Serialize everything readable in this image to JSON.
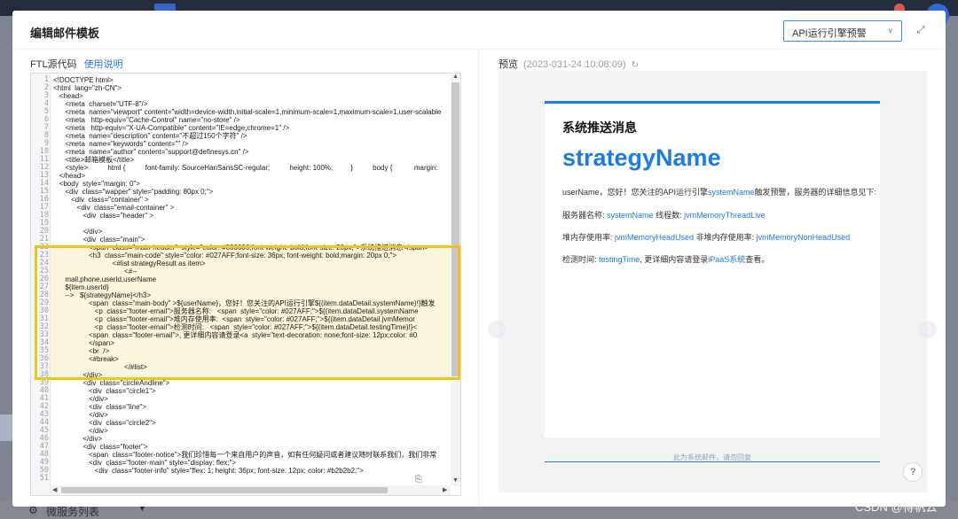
{
  "modal": {
    "title": "编辑邮件模板",
    "template_select": "API运行引擎预警",
    "expand_icon": "fullscreen-icon"
  },
  "editor": {
    "label": "FTL源代码",
    "help_link": "使用说明",
    "lines": [
      {
        "n": "1",
        "t": "<!DOCTYPE html>"
      },
      {
        "n": "2",
        "t": "<html  lang=\"zh-CN\">"
      },
      {
        "n": "3",
        "t": "   <head>"
      },
      {
        "n": "4",
        "t": "      <meta  charset=\"UTF-8\"/>"
      },
      {
        "n": "5",
        "t": "      <meta  name=\"viewport\" content=\"width=device-width,initial-scale=1,minimum-scale=1,maximum-scale=1,user-scalable"
      },
      {
        "n": "6",
        "t": "      <meta   http-equiv=\"Cache-Control\" name=\"no-store\" />"
      },
      {
        "n": "7",
        "t": "      <meta   http-equiv=\"X-UA-Compatible\" content=\"IE=edge,chrome=1\" />"
      },
      {
        "n": "8",
        "t": "      <meta  name=\"description\" content=\"不超过150个字符\" />"
      },
      {
        "n": "9",
        "t": "      <meta  name=\"keywords\" content=\"\" />"
      },
      {
        "n": "10",
        "t": "      <meta  name=\"author\" content=\"support@definesys.cn\" />"
      },
      {
        "n": "11",
        "t": "      <title>邮箱模板</title>"
      },
      {
        "n": "12",
        "t": "      <style>          html {          font-family: SourceHanSansSC-regular;          height: 100%;         }          body {           margin:"
      },
      {
        "n": "13",
        "t": "   </head>"
      },
      {
        "n": "14",
        "t": "   <body  style=\"margin: 0\">"
      },
      {
        "n": "15",
        "t": "      <div  class=\"wapper\" style=\"padding: 80px 0;\">"
      },
      {
        "n": "16",
        "t": "         <div  class=\"container\" >"
      },
      {
        "n": "17",
        "t": "            <div  class=\"email-container\" >"
      },
      {
        "n": "18",
        "t": "               <div  class=\"header\" >"
      },
      {
        "n": "19",
        "t": ""
      },
      {
        "n": "20",
        "t": "               </div>"
      },
      {
        "n": "21",
        "t": "               <div  class=\"main\">"
      },
      {
        "n": "22",
        "t": "                  <span  class=\"main-header\"  style=\"color: #000000;font-weight: bold;font-size: 20px;\">系统推送消息</span>"
      },
      {
        "n": "23",
        "t": "                  <h3  class=\"main-code\" style=\"color: #027AFF;font-size: 36px; font-weight: bold;margin: 20px 0;\">"
      },
      {
        "n": "24",
        "t": "                              <#list strategyResult as item>"
      },
      {
        "n": "25",
        "t": "                                    <#--"
      },
      {
        "n": "26",
        "t": "      mail,phone,userId,userName"
      },
      {
        "n": "27",
        "t": "      ${item.userId}"
      },
      {
        "n": "28",
        "t": "      -->   ${strategyName}</h3>"
      },
      {
        "n": "29",
        "t": "                  <span  class=\"main-body\" >${userName}，您好！您关注的API运行引擎${(item.dataDetail.systemName)!}触发"
      },
      {
        "n": "30",
        "t": "                     <p  class=\"footer-email\">服务器名称:   <span  style=\"color: #027AFF;\">${(item.dataDetail.systemName"
      },
      {
        "n": "31",
        "t": "                     <p  class=\"footer-email\">堆内存使用率:  <span  style=\"color: #027AFF;\">${(item.dataDetail.jvmMemor"
      },
      {
        "n": "32",
        "t": "                     <p  class=\"footer-email\">检测时间:   <span  style=\"color: #027AFF;\">${(item.dataDetail.testingTime)!}<"
      },
      {
        "n": "33",
        "t": "                  <span  class=\"footer-email\">, 更详细内容请登录<a  style=\"text-decoration: none;font-size: 12px;color: #0"
      },
      {
        "n": "34",
        "t": "                  </span>"
      },
      {
        "n": "35",
        "t": "                  <br  />"
      },
      {
        "n": "36",
        "t": "                  <#break>"
      },
      {
        "n": "37",
        "t": "                                    </#list>"
      },
      {
        "n": "38",
        "t": "               </div>"
      },
      {
        "n": "39",
        "t": "               <div  class=\"circleAndline\">"
      },
      {
        "n": "40",
        "t": "                  <div  class=\"circle1\">"
      },
      {
        "n": "41",
        "t": "                  </div>"
      },
      {
        "n": "42",
        "t": "                  <div  class=\"line\">"
      },
      {
        "n": "43",
        "t": "                  </div>"
      },
      {
        "n": "44",
        "t": "                  <div  class=\"circle2\">"
      },
      {
        "n": "45",
        "t": "                  </div>"
      },
      {
        "n": "46",
        "t": "               </div>"
      },
      {
        "n": "47",
        "t": "               <div  class=\"footer\">"
      },
      {
        "n": "48",
        "t": "                  <span  class=\"footer-notice\">我们珍惜每一个来自用户的声音，如有任何疑问或者建议随时联系我们，我们非常"
      },
      {
        "n": "49",
        "t": "                  <div  class=\"footer-main\" style=\"display: flex;\">"
      },
      {
        "n": "50",
        "t": "                     <div  class=\"footer-info\" style=\"flex: 1; height: 36px; font-size: 12px; color: #b2b2b2;\">"
      },
      {
        "n": "51",
        "t": ""
      }
    ]
  },
  "preview": {
    "label": "预览",
    "timestamp": "(2023-031-24 10:08:09)",
    "title": "系统推送消息",
    "strategy": "strategyName",
    "body": {
      "before": "userName，您好！您关注的API运行引擎",
      "system": "systemName",
      "after": "触发预警，服务器的详细信息见下:"
    },
    "row1": {
      "label": "服务器名称:",
      "v1": "systemName",
      "mid": "线程数:",
      "v2": "jvmMemoryThreadLive"
    },
    "row2": {
      "label": "堆内存使用率:",
      "v1": "jvmMemoryHeadUsed",
      "mid": "非堆内存使用率:",
      "v2": "jvmMemoryNonHeadUsed"
    },
    "row3": {
      "label": "检测时间:",
      "v1": "testingTime",
      "mid": ", 更详细内容请登录",
      "link": "iPaaS系统",
      "end": "查看。"
    },
    "footer": "此为系统邮件，请勿回复"
  },
  "background": {
    "footer_item": "微服务列表"
  },
  "watermark": "CSDN @得帆云",
  "colors": {
    "accent": "#1a7bef",
    "highlight_border": "#f0c419",
    "highlight_bg": "#fbf6dd"
  }
}
